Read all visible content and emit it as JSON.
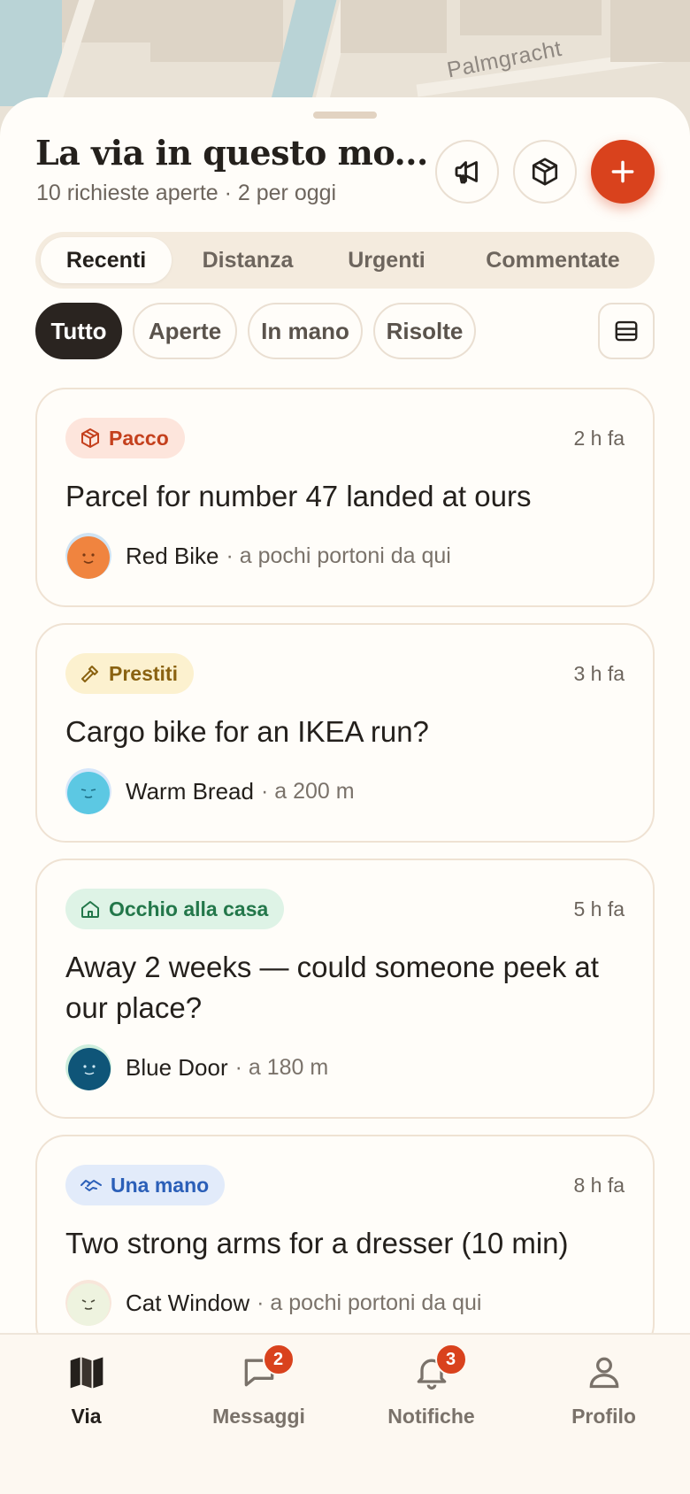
{
  "map": {
    "street_label": "Palmgracht"
  },
  "header": {
    "title": "La via in questo mo...",
    "subtitle": "10 richieste aperte · 2 per oggi",
    "actions": [
      {
        "icon": "megaphone-icon"
      },
      {
        "icon": "package-icon"
      },
      {
        "icon": "plus-icon"
      }
    ]
  },
  "sort_tabs": {
    "selected": "Recenti",
    "items": [
      "Recenti",
      "Distanza",
      "Urgenti",
      "Commentate"
    ]
  },
  "filters": {
    "selected": "Tutto",
    "items": [
      "Tutto",
      "Aperte",
      "In mano",
      "Risolte"
    ],
    "view_toggle_icon": "list-view-icon"
  },
  "requests": [
    {
      "tag": "Pacco",
      "tag_icon": "package-icon",
      "tag_bg": "#fde5dc",
      "tag_color": "#c4401d",
      "time": "2 h fa",
      "title": "Parcel for number 47 landed at ours",
      "author": "Red Bike",
      "meta": "· a pochi portoni da qui",
      "avatar_color": "#f0843f"
    },
    {
      "tag": "Prestiti",
      "tag_icon": "hammer-icon",
      "tag_bg": "#fcf1cf",
      "tag_color": "#8a6211",
      "time": "3 h fa",
      "title": "Cargo bike for an IKEA run?",
      "author": "Warm Bread",
      "meta": "· a 200 m",
      "avatar_color": "#5cc8e3"
    },
    {
      "tag": "Occhio alla casa",
      "tag_icon": "house-icon",
      "tag_bg": "#def3e6",
      "tag_color": "#23774a",
      "time": "5 h fa",
      "title": "Away 2 weeks — could someone peek at our place?",
      "author": "Blue Door",
      "meta": "· a 180 m",
      "avatar_color": "#0f5578"
    },
    {
      "tag": "Una mano",
      "tag_icon": "handshake-icon",
      "tag_bg": "#e2ebfa",
      "tag_color": "#2b5fb8",
      "time": "8 h fa",
      "title": "Two strong arms for a dresser (10 min)",
      "author": "Cat Window",
      "meta": "· a pochi portoni da qui",
      "avatar_color": "#eef3df"
    }
  ],
  "tabbar": {
    "active": "Via",
    "items": [
      {
        "label": "Via",
        "icon": "map-icon",
        "badge": ""
      },
      {
        "label": "Messaggi",
        "icon": "chat-icon",
        "badge": "2"
      },
      {
        "label": "Notifiche",
        "icon": "bell-icon",
        "badge": "3"
      },
      {
        "label": "Profilo",
        "icon": "user-icon",
        "badge": ""
      }
    ]
  },
  "colors": {
    "accent": "#d9421d",
    "ink": "#24201c",
    "muted": "#6d655d",
    "surface": "#fffdf9"
  }
}
